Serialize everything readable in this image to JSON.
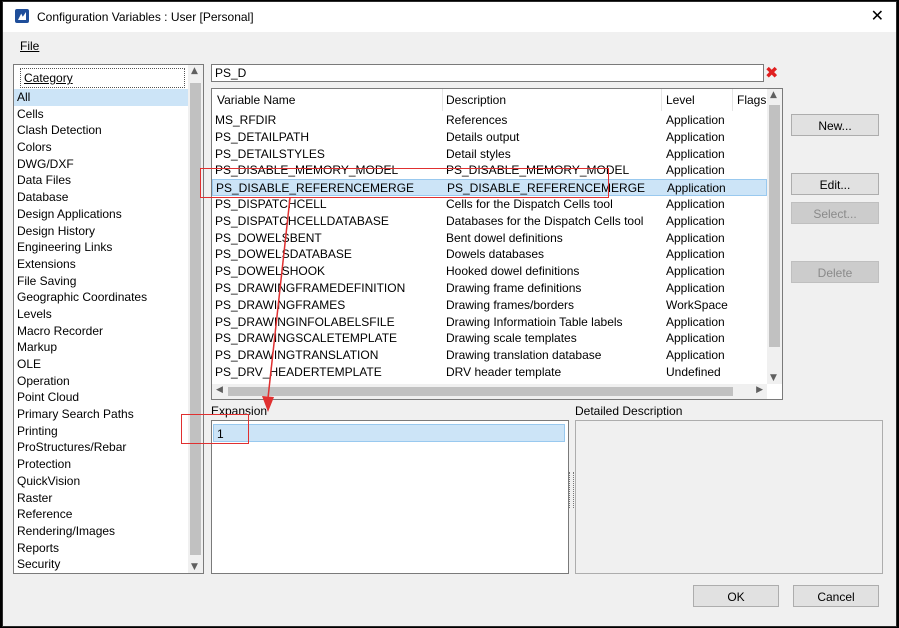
{
  "window": {
    "title": "Configuration Variables : User [Personal]"
  },
  "menu": {
    "file": "File"
  },
  "categories": {
    "header": "Category",
    "items": [
      "All",
      "Cells",
      "Clash Detection",
      "Colors",
      "DWG/DXF",
      "Data Files",
      "Database",
      "Design Applications",
      "Design History",
      "Engineering Links",
      "Extensions",
      "File Saving",
      "Geographic Coordinates",
      "Levels",
      "Macro Recorder",
      "Markup",
      "OLE",
      "Operation",
      "Point Cloud",
      "Primary Search Paths",
      "Printing",
      "ProStructures/Rebar",
      "Protection",
      "QuickVision",
      "Raster",
      "Reference",
      "Rendering/Images",
      "Reports",
      "Security"
    ],
    "selected": "All"
  },
  "search": {
    "value": "PS_D"
  },
  "table": {
    "headers": [
      "Variable Name",
      "Description",
      "Level",
      "Flags"
    ],
    "rows": [
      [
        "MS_RFDIR",
        "References",
        "Application"
      ],
      [
        "PS_DETAILPATH",
        "Details output",
        "Application"
      ],
      [
        "PS_DETAILSTYLES",
        "Detail styles",
        "Application"
      ],
      [
        "PS_DISABLE_MEMORY_MODEL",
        "PS_DISABLE_MEMORY_MODEL",
        "Application"
      ],
      [
        "PS_DISABLE_REFERENCEMERGE",
        "PS_DISABLE_REFERENCEMERGE",
        "Application"
      ],
      [
        "PS_DISPATCHCELL",
        "Cells for the Dispatch Cells tool",
        "Application"
      ],
      [
        "PS_DISPATCHCELLDATABASE",
        "Databases for the Dispatch Cells tool",
        "Application"
      ],
      [
        "PS_DOWELSBENT",
        "Bent dowel definitions",
        "Application"
      ],
      [
        "PS_DOWELSDATABASE",
        "Dowels databases",
        "Application"
      ],
      [
        "PS_DOWELSHOOK",
        "Hooked dowel definitions",
        "Application"
      ],
      [
        "PS_DRAWINGFRAMEDEFINITION",
        "Drawing frame definitions",
        "Application"
      ],
      [
        "PS_DRAWINGFRAMES",
        "Drawing frames/borders",
        "WorkSpace"
      ],
      [
        "PS_DRAWINGINFOLABELSFILE",
        "Drawing Informatioin Table labels",
        "Application"
      ],
      [
        "PS_DRAWINGSCALETEMPLATE",
        "Drawing scale templates",
        "Application"
      ],
      [
        "PS_DRAWINGTRANSLATION",
        "Drawing translation database",
        "Application"
      ],
      [
        "PS_DRV_HEADERTEMPLATE",
        "DRV header template",
        "Undefined"
      ]
    ],
    "selected_row": 4
  },
  "buttons": {
    "new": "New...",
    "edit": "Edit...",
    "select": "Select...",
    "delete": "Delete",
    "ok": "OK",
    "cancel": "Cancel"
  },
  "expansion": {
    "label": "Expansion",
    "value": "1"
  },
  "detailed_description": {
    "label": "Detailed Description"
  },
  "colors": {
    "selection": "#cce4f7",
    "annotation": "#e03030",
    "clear_icon": "#e02020"
  },
  "icons": [
    "app-icon",
    "close-icon",
    "clear-search-icon",
    "scroll-arrow-icon"
  ]
}
